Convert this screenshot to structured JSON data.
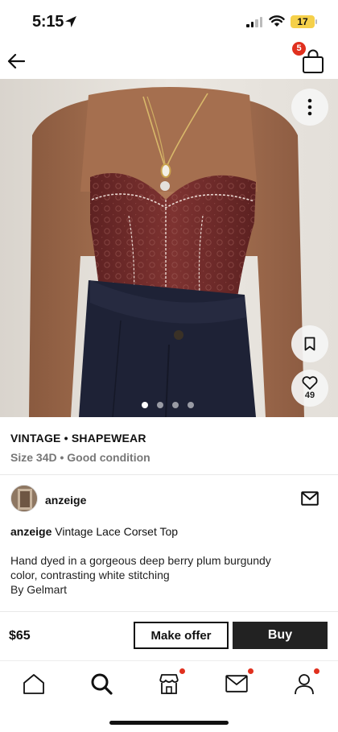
{
  "status_bar": {
    "time": "5:15",
    "battery": "17"
  },
  "header": {
    "cart_count": "5"
  },
  "product": {
    "like_count": "49",
    "category": "VINTAGE • SHAPEWEAR",
    "size_condition": "Size 34D • Good condition",
    "seller": "anzeige",
    "title_seller": "anzeige",
    "title": "Vintage Lace Corset Top",
    "description_lines": [
      "Hand dyed in a gorgeous deep berry plum burgundy",
      "color, contrasting white stitching",
      "By Gelmart"
    ],
    "price": "$65",
    "image_count": 4,
    "active_image": 1
  },
  "actions": {
    "offer_label": "Make offer",
    "buy_label": "Buy"
  },
  "tabs": [
    {
      "name": "home-icon",
      "badge": false
    },
    {
      "name": "search-icon",
      "badge": false
    },
    {
      "name": "shop-icon",
      "badge": true
    },
    {
      "name": "inbox-icon",
      "badge": true
    },
    {
      "name": "profile-icon",
      "badge": true
    }
  ],
  "colors": {
    "accent_badge": "#e0301e",
    "garment": "#7a2f2e",
    "button_dark": "#222222"
  }
}
